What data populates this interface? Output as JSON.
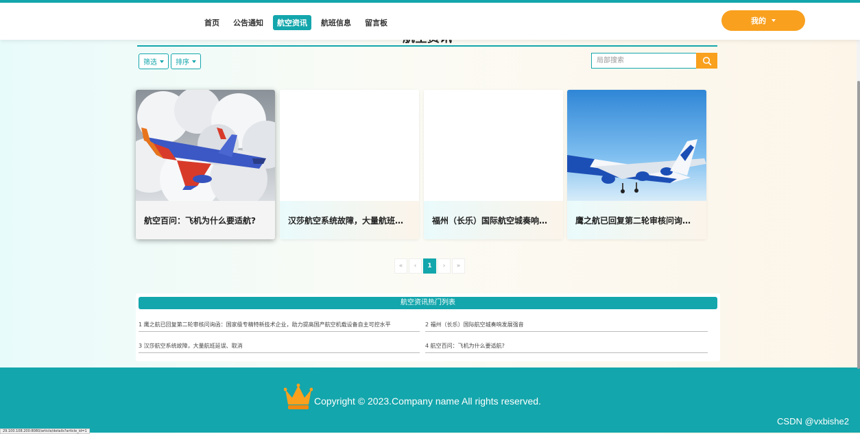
{
  "nav": {
    "items": [
      {
        "label": "首页",
        "active": false
      },
      {
        "label": "公告通知",
        "active": false
      },
      {
        "label": "航空资讯",
        "active": true
      },
      {
        "label": "航班信息",
        "active": false
      },
      {
        "label": "留言板",
        "active": false
      }
    ],
    "me_label": "我的"
  },
  "page": {
    "title": "航空资讯"
  },
  "toolbar": {
    "filter_label": "筛选",
    "sort_label": "排序",
    "search_placeholder": "局部搜索"
  },
  "cards": [
    {
      "title": "航空百问：飞机为什么要适航?",
      "image": "plane-clouds"
    },
    {
      "title": "汉莎航空系统故障，大量航班延误、取消",
      "image": "blank"
    },
    {
      "title": "福州（长乐）国际航空城奏响发展强音",
      "image": "blank"
    },
    {
      "title": "鹰之航已回复第二轮审核问询函：国家级专精特新",
      "image": "plane-sky"
    }
  ],
  "pagination": {
    "first": "«",
    "prev": "‹",
    "current": "1",
    "next": "›",
    "last": "»"
  },
  "hot_list": {
    "title": "航空资讯热门列表",
    "items": [
      {
        "text": "1  鹰之航已回复第二轮审核问询函：国家级专精特新技术企业，助力提高国产航空机载设备自主可控水平"
      },
      {
        "text": "2  福州（长乐）国际航空城奏响发展强音"
      },
      {
        "text": "3  汉莎航空系统故障，大量航班延误、取消"
      },
      {
        "text": "4  航空百问：飞机为什么要适航?"
      }
    ]
  },
  "footer": {
    "copyright": "Copyright © 2023.Company name All rights reserved.",
    "watermark": "CSDN @vxbishe2"
  },
  "status_url": "29.100.108.200:8080/article/details?article_id=1",
  "colors": {
    "primary": "#13a6ac",
    "accent": "#f9a01e"
  }
}
